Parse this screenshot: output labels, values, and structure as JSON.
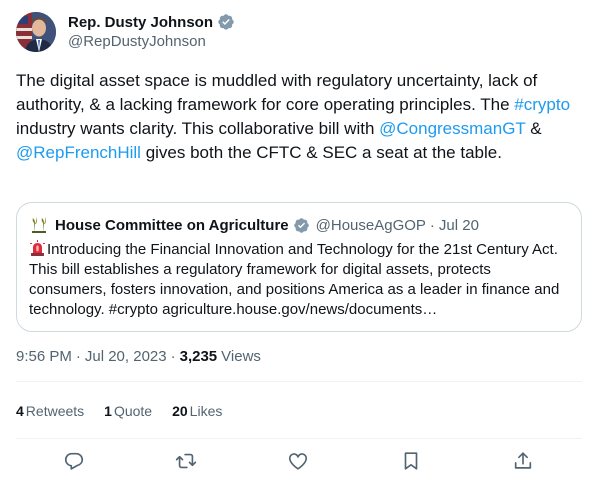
{
  "author": {
    "display_name": "Rep. Dusty Johnson",
    "handle": "@RepDustyJohnson"
  },
  "tweet": {
    "text_1": "The digital asset space is muddled with regulatory uncertainty, lack of authority, & a lacking framework for core operating principles. The ",
    "hashtag_crypto": "#crypto",
    "text_2": " industry wants clarity. This collaborative bill with ",
    "mention_1": "@CongressmanGT",
    "text_3": " & ",
    "mention_2": "@RepFrenchHill",
    "text_4": " gives both the CFTC & SEC a seat at the table."
  },
  "quoted": {
    "name": "House Committee on Agriculture",
    "handle": "@HouseAgGOP",
    "separator": "·",
    "date": "Jul 20",
    "text": "Introducing the Financial Innovation and Technology for the 21st Century Act. This bill establishes a regulatory framework for digital assets, protects consumers, fosters innovation, and positions America as a leader in finance and technology. #crypto agriculture.house.gov/news/documents…"
  },
  "meta": {
    "time": "9:56 PM",
    "separator": "·",
    "date": "Jul 20, 2023",
    "views_count": "3,235",
    "views_label": "Views"
  },
  "stats": {
    "retweets_count": "4",
    "retweets_label": "Retweets",
    "quotes_count": "1",
    "quotes_label": "Quote",
    "likes_count": "20",
    "likes_label": "Likes"
  },
  "icons": {
    "verified": "verified-badge-icon",
    "reply": "reply-icon",
    "retweet": "retweet-icon",
    "like": "heart-icon",
    "bookmark": "bookmark-icon",
    "share": "share-icon"
  },
  "colors": {
    "link": "#1d9bf0",
    "secondary_text": "#536471",
    "border": "#cfd9de",
    "verified_gray": "#829aab"
  }
}
